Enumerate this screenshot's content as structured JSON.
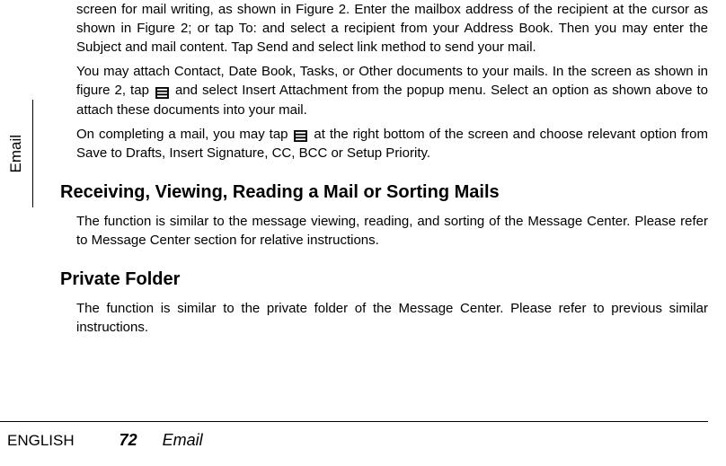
{
  "sideTab": "Email",
  "paragraphs": {
    "p1": "screen for mail writing, as shown in Figure 2. Enter the mailbox address of the recipient at the cursor as shown in Figure 2; or tap To: and select a recipient from your Address Book. Then you may enter the Subject and mail content. Tap Send and select link method to send your mail.",
    "p2a": "You may attach Contact, Date Book, Tasks, or Other documents to your mails. In the screen as shown in figure 2, tap ",
    "p2b": " and select Insert Attachment from the popup menu. Select an option as shown above to attach these documents into your mail.",
    "p3a": "On completing a mail, you may tap ",
    "p3b": " at the right bottom of the screen and choose relevant option from Save to Drafts, Insert Signature, CC, BCC or Setup Priority."
  },
  "headings": {
    "h1": "Receiving, Viewing, Reading a Mail or Sorting Mails",
    "h2": "Private Folder"
  },
  "bodies": {
    "b1": "The function is similar to the message viewing, reading, and sorting of the Message Center. Please refer to Message Center section for relative instructions.",
    "b2": "The function is similar to the private folder of the Message Center. Please refer to previous similar instructions."
  },
  "footer": {
    "lang": "ENGLISH",
    "page": "72",
    "title": "Email"
  }
}
